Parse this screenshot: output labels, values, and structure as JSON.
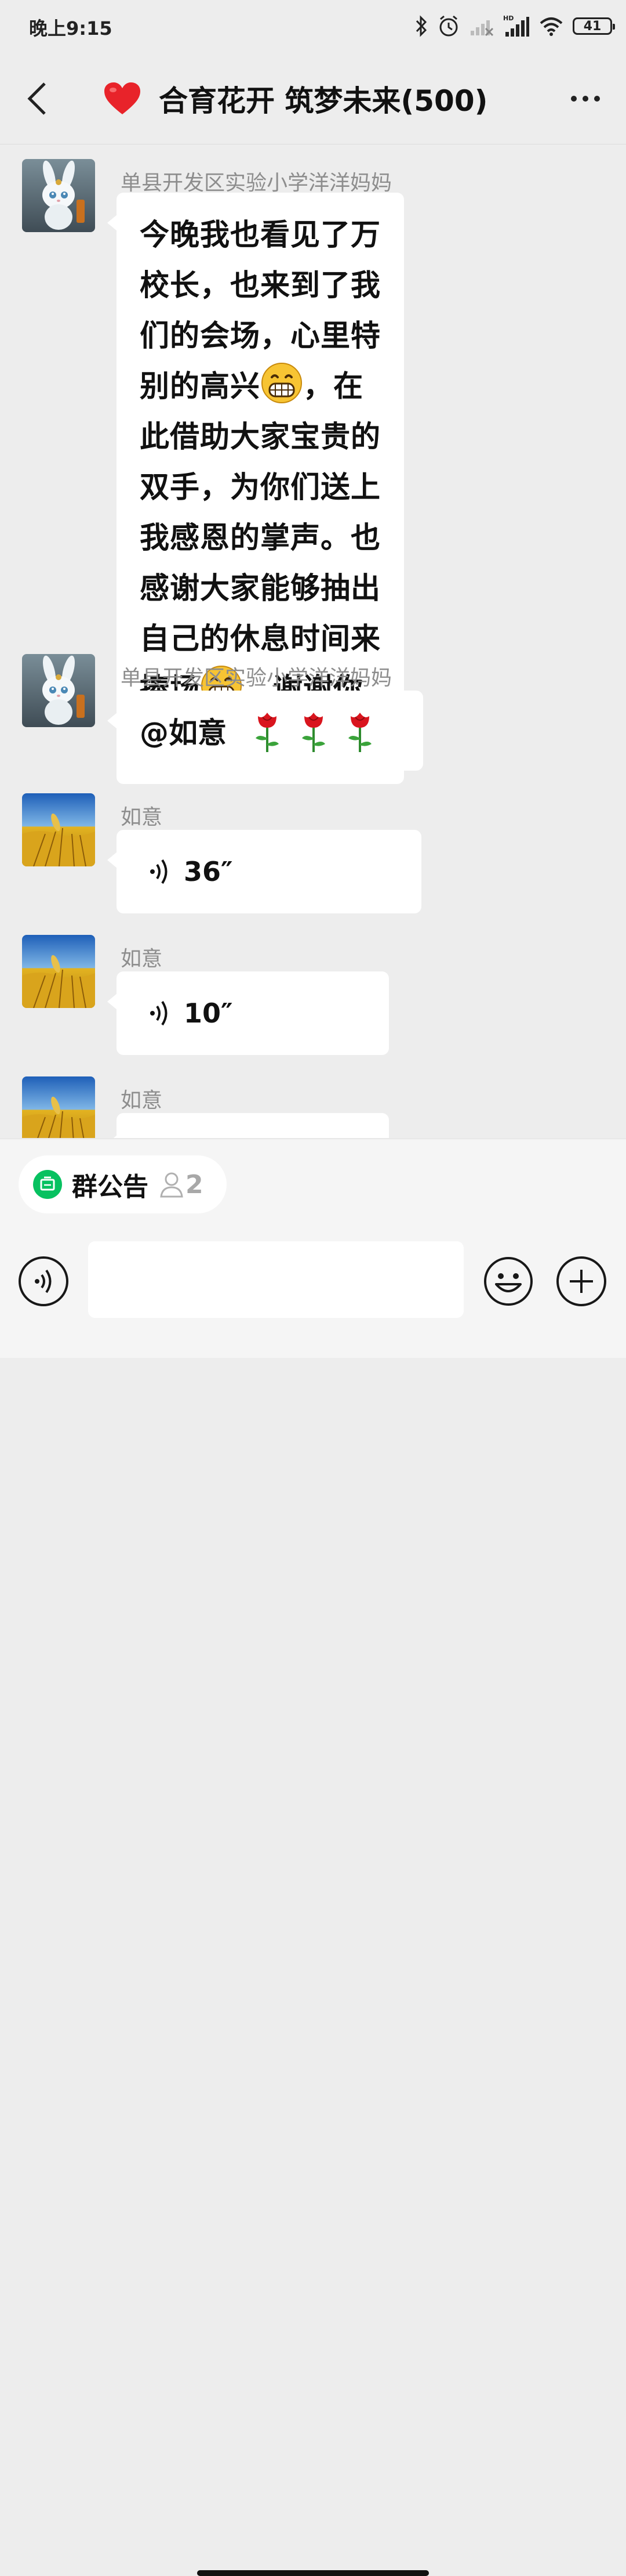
{
  "status_bar": {
    "time": "晚上9:15",
    "battery": "41",
    "icons": [
      "bluetooth-icon",
      "alarm-icon",
      "signal-off-icon",
      "hd-signal-icon",
      "wifi-icon",
      "battery-icon"
    ]
  },
  "header": {
    "title": "合育花开 筑梦未来(500)",
    "icons": [
      "back-icon",
      "heart-icon",
      "more-icon"
    ]
  },
  "messages": [
    {
      "sender": "单县开发区实验小学洋洋妈妈",
      "type": "text",
      "parts": [
        "今晚我也看见了万校长，也来到了我们的会场，心里特别的高兴",
        "，在此借助大家宝贵的双手，为你们送上我感恩的掌声。也感谢大家能够抽出自己的休息时间来捧场",
        "，谢谢你们。"
      ],
      "emoji": "grinning-face-icon"
    },
    {
      "sender": "单县开发区实验小学洋洋妈妈",
      "type": "mention",
      "text": "@如意",
      "emoji": "rose-icon",
      "emoji_count": 3
    },
    {
      "sender": "如意",
      "type": "voice",
      "duration": "36″"
    },
    {
      "sender": "如意",
      "type": "voice",
      "duration": "10″"
    },
    {
      "sender": "如意",
      "type": "voice",
      "duration": ""
    }
  ],
  "notice": {
    "label": "群公告",
    "count": "2"
  },
  "input": {
    "value": ""
  },
  "colors": {
    "background": "#ededed",
    "bubble": "#ffffff",
    "sender_name": "#8d8d8d",
    "notice_green": "#07c160",
    "heart_red": "#e8232a"
  }
}
